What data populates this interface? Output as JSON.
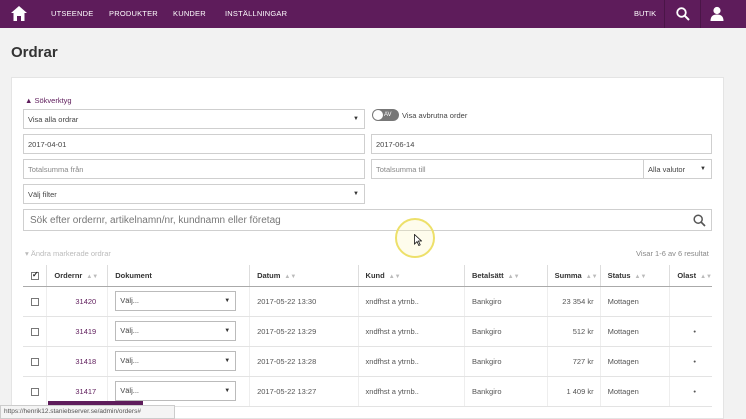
{
  "topbar": {
    "nav": [
      "UTSEENDE",
      "PRODUKTER",
      "KUNDER",
      "INSTÄLLNINGAR"
    ],
    "butik": "BUTIK",
    "icons": {
      "home": "home-icon",
      "search": "search-icon",
      "user": "user-icon"
    }
  },
  "page": {
    "title": "Ordrar"
  },
  "tools": {
    "toggle_label": "▲ Sökverktyg",
    "order_filter": "Visa alla ordrar",
    "cancelled_toggle": "AV",
    "cancelled_label": "Visa avbrutna order",
    "date_from": "2017-04-01",
    "date_to": "2017-06-14",
    "total_from_placeholder": "Totalsumma från",
    "total_to_placeholder": "Totalsumma till",
    "currency": "Alla valutor",
    "filter": "Välj filter",
    "search_placeholder": "Sök efter ordernr, artikelnamn/nr, kundnamn eller företag"
  },
  "list": {
    "bulk_label": "▾ Ändra markerade ordrar",
    "result_count": "Visar 1-6 av 6 resultat",
    "columns": [
      "Ordernr",
      "Dokument",
      "Datum",
      "Kund",
      "Betalsätt",
      "Summa",
      "Status",
      "Olast"
    ],
    "rows": [
      {
        "ordernr": "31420",
        "dokument": "Välj...",
        "datum": "2017-05-22 13:30",
        "kund": "xndfhst a ytrnb..",
        "betalsatt": "Bankgiro",
        "summa": "23 354 kr",
        "status": "Mottagen",
        "olast": ""
      },
      {
        "ordernr": "31419",
        "dokument": "Välj...",
        "datum": "2017-05-22 13:29",
        "kund": "xndfhst a ytrnb..",
        "betalsatt": "Bankgiro",
        "summa": "512 kr",
        "status": "Mottagen",
        "olast": "•"
      },
      {
        "ordernr": "31418",
        "dokument": "Välj...",
        "datum": "2017-05-22 13:28",
        "kund": "xndfhst a ytrnb..",
        "betalsatt": "Bankgiro",
        "summa": "727 kr",
        "status": "Mottagen",
        "olast": "•"
      },
      {
        "ordernr": "31417",
        "dokument": "Välj...",
        "datum": "2017-05-22 13:27",
        "kund": "xndfhst a ytrnb..",
        "betalsatt": "Bankgiro",
        "summa": "1 409 kr",
        "status": "Mottagen",
        "olast": "•"
      }
    ]
  },
  "statusbar": {
    "url": "https://henrik12.staniebserver.se/admin/orders#"
  },
  "colors": {
    "brand": "#5e1c5b",
    "cursor_highlight": "#ede06a"
  }
}
